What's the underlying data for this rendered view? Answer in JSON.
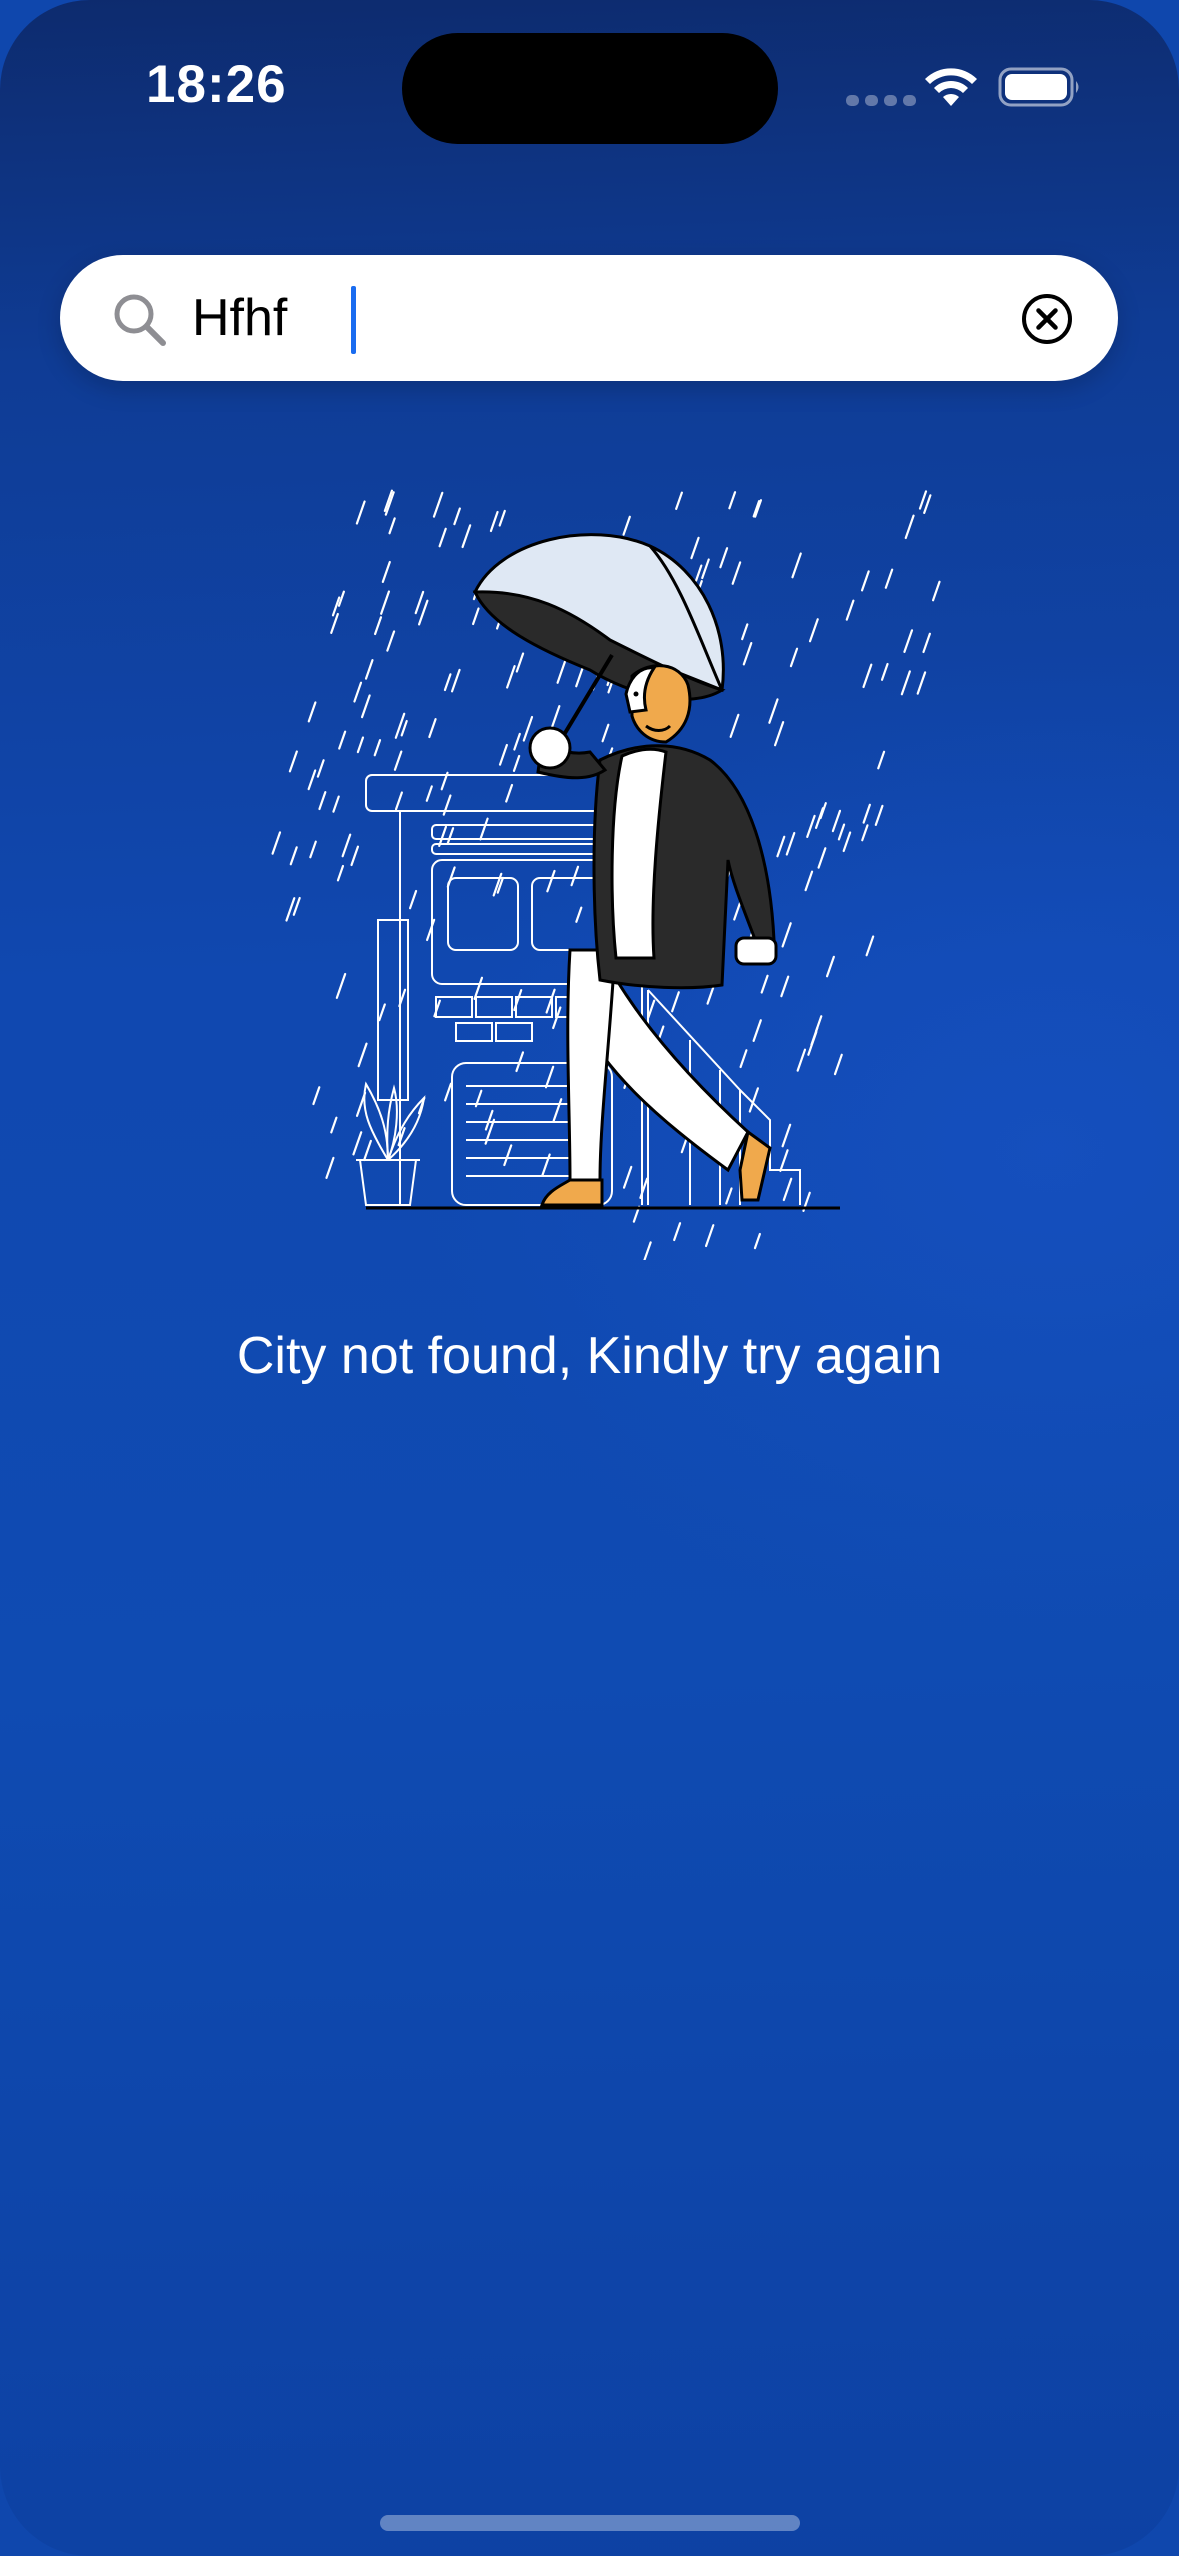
{
  "status_bar": {
    "time": "18:26",
    "wifi_icon": "wifi-icon",
    "battery_icon": "battery-icon",
    "signal_icon": "cellular-signal-icon"
  },
  "search": {
    "value": "Hfhf",
    "search_icon": "search-icon",
    "clear_icon": "clear-circle-x-icon"
  },
  "empty_state": {
    "illustration": "man-with-umbrella-in-rain",
    "message": "City not found, Kindly try again"
  },
  "colors": {
    "background_top": "#0d2b6e",
    "background_main": "#1048b0",
    "search_background": "#ffffff",
    "caret": "#1a6cf0",
    "text_on_background": "#ffffff"
  }
}
